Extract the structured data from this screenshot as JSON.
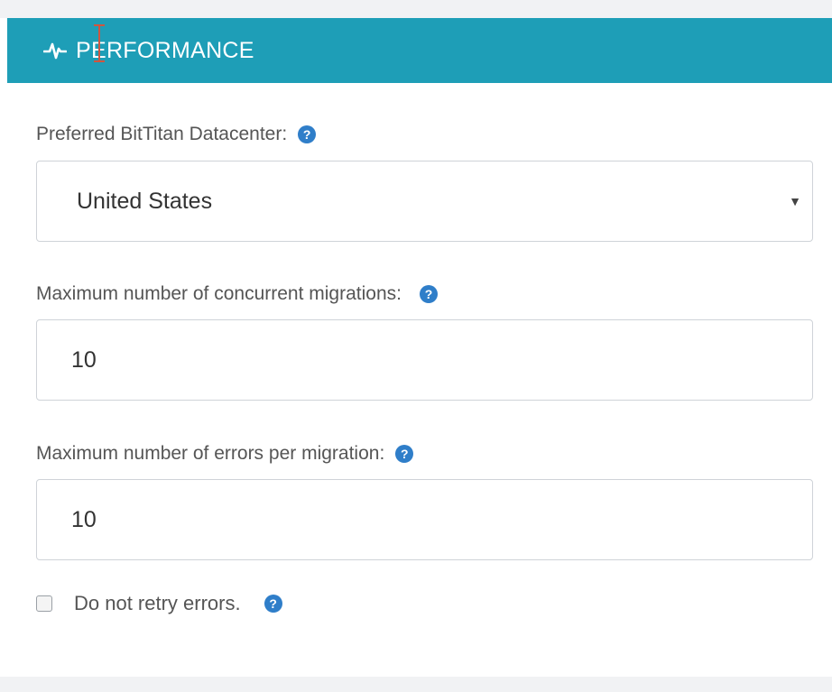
{
  "panel": {
    "title": "PERFORMANCE",
    "icon": "pulse-icon"
  },
  "fields": {
    "datacenter": {
      "label": "Preferred BitTitan Datacenter:",
      "value": "United States",
      "help_icon": "question-circle-icon"
    },
    "concurrent": {
      "label": "Maximum number of concurrent migrations:",
      "value": "10",
      "help_icon": "question-circle-icon"
    },
    "errors": {
      "label": "Maximum number of errors per migration:",
      "value": "10",
      "help_icon": "question-circle-icon"
    },
    "no_retry": {
      "label": "Do not retry errors.",
      "checked": false,
      "help_icon": "question-circle-icon"
    }
  },
  "colors": {
    "header_bg": "#1e9eb7",
    "help_icon": "#2f7ec9",
    "cursor": "#d0553f"
  }
}
